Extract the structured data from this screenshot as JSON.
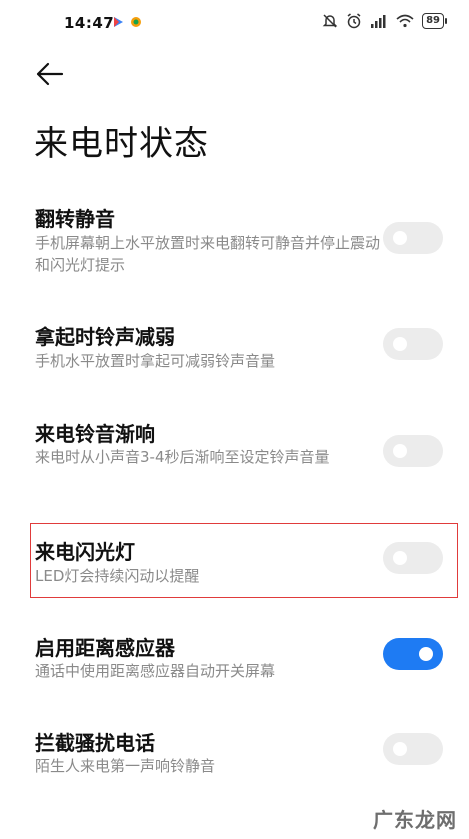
{
  "status_bar": {
    "time": "14:47",
    "battery": "89",
    "icons_left": [
      "play-store-icon",
      "maps-icon"
    ],
    "icons_right": [
      "mute-icon",
      "alarm-icon",
      "signal-icon",
      "wifi-icon",
      "battery-icon"
    ]
  },
  "header": {
    "back_icon": "arrow-left-icon",
    "title": "来电时状态"
  },
  "settings": [
    {
      "title": "翻转静音",
      "desc": "手机屏幕朝上水平放置时来电翻转可静音并停止震动和闪光灯提示",
      "enabled": false
    },
    {
      "title": "拿起时铃声减弱",
      "desc": "手机水平放置时拿起可减弱铃声音量",
      "enabled": false
    },
    {
      "title": "来电铃音渐响",
      "desc": "来电时从小声音3-4秒后渐响至设定铃声音量",
      "enabled": false
    },
    {
      "title": "来电闪光灯",
      "desc": "LED灯会持续闪动以提醒",
      "enabled": false
    },
    {
      "title": "启用距离感应器",
      "desc": "通话中使用距离感应器自动开关屏幕",
      "enabled": true
    },
    {
      "title": "拦截骚扰电话",
      "desc": "陌生人来电第一声响铃静音",
      "enabled": false
    }
  ],
  "colors": {
    "accent": "#1e7bf3",
    "toggle_off": "#ececec",
    "highlight_border": "#e03b3b",
    "desc_text": "#8a8a8a"
  },
  "watermark": "广东龙网"
}
